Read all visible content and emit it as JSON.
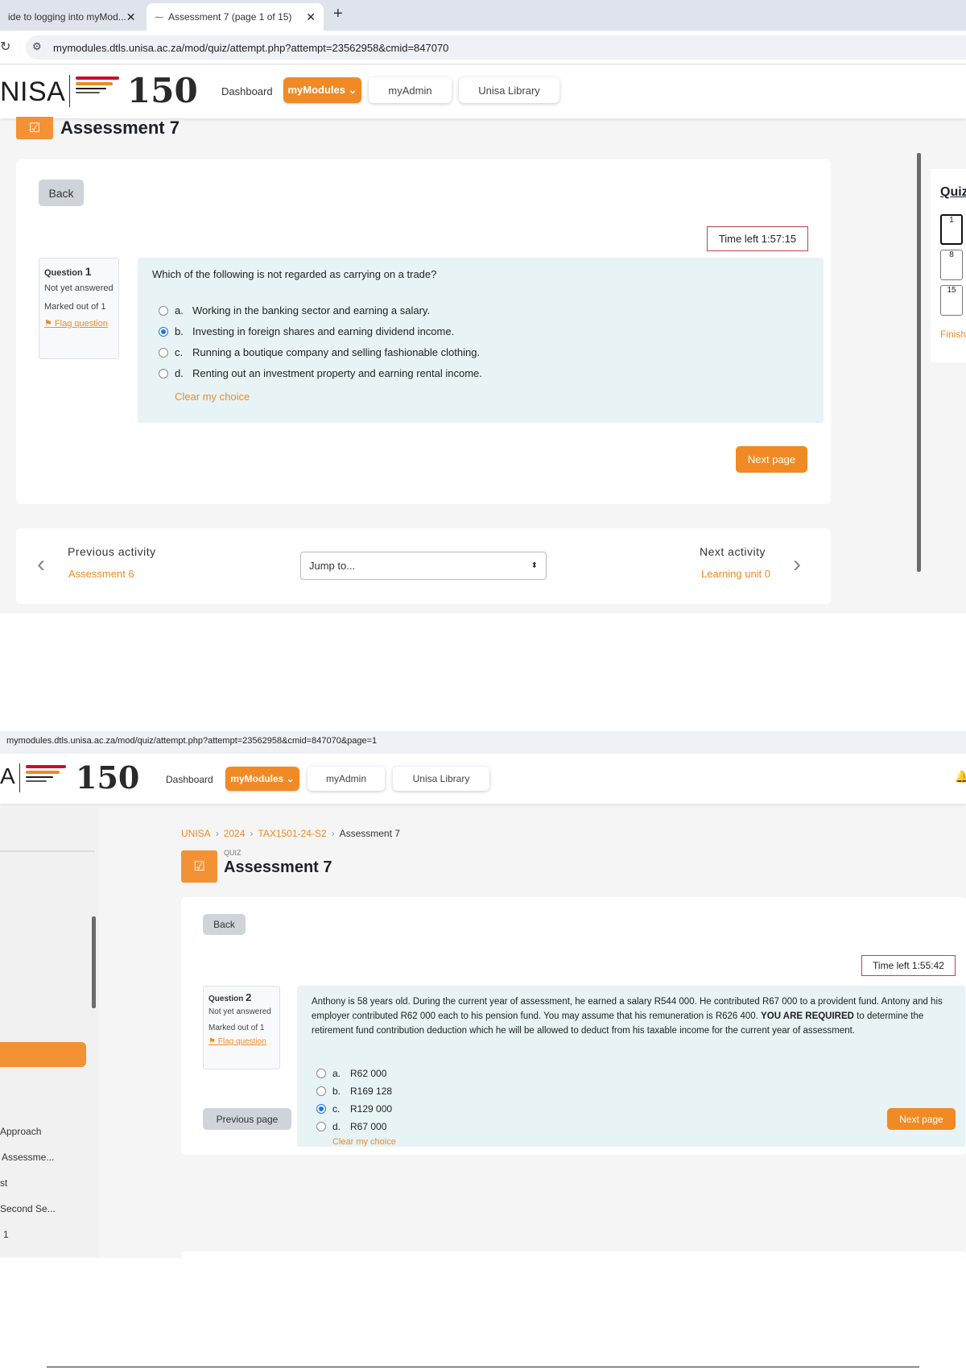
{
  "colors": {
    "accent": "#f08a24",
    "timer_border": "#c8404b",
    "question_bg": "#e7f3f5",
    "selected_radio": "#1a73e8"
  },
  "shot1": {
    "browser": {
      "tab_inactive": "ide to logging into myMod...",
      "tab_active": "Assessment 7 (page 1 of 15)",
      "tab_close": "✕",
      "new_tab": "+",
      "url": "mymodules.dtls.unisa.ac.za/mod/quiz/attempt.php?attempt=23562958&cmid=847070"
    },
    "nav": {
      "logo_text": "NISA",
      "logo_150": "150",
      "dashboard": "Dashboard",
      "mymodules": "myModules ⌄",
      "myadmin": "myAdmin",
      "library": "Unisa Library"
    },
    "page_title": "Assessment 7",
    "back": "Back",
    "timer": "Time left 1:57:15",
    "question": {
      "label": "Question",
      "number": "1",
      "state": "Not yet answered",
      "marked": "Marked out of 1",
      "flag": "Flag question",
      "text": "Which of the following is not regarded as carrying on a trade?",
      "options": [
        {
          "letter": "a.",
          "text": "Working in the banking sector and earning a salary.",
          "selected": false
        },
        {
          "letter": "b.",
          "text": "Investing in foreign shares and earning dividend income.",
          "selected": true
        },
        {
          "letter": "c.",
          "text": "Running a boutique company and selling fashionable clothing.",
          "selected": false
        },
        {
          "letter": "d.",
          "text": "Renting out an investment property and earning rental income.",
          "selected": false
        }
      ],
      "clear": "Clear my choice"
    },
    "next_page": "Next page",
    "activity": {
      "prev_heading": "Previous activity",
      "prev_link": "Assessment 6",
      "jump": "Jump to...",
      "next_heading": "Next activity",
      "next_link": "Learning unit 0"
    },
    "quiz_nav": {
      "title": "Quiz",
      "cells": [
        "1",
        "8",
        "15"
      ],
      "finish": "Finish"
    }
  },
  "shot2": {
    "url": "mymodules.dtls.unisa.ac.za/mod/quiz/attempt.php?attempt=23562958&cmid=847070&page=1",
    "nav": {
      "logo_text": "A",
      "logo_150": "150",
      "dashboard": "Dashboard",
      "mymodules": "myModules ⌄",
      "myadmin": "myAdmin",
      "library": "Unisa Library"
    },
    "sidebar_items": [
      "Approach",
      "Assessme...",
      "st",
      "Second Se...",
      "1"
    ],
    "breadcrumb": [
      "UNISA",
      "2024",
      "TAX1501-24-S2",
      "Assessment 7"
    ],
    "quiz_label": "QUIZ",
    "page_title": "Assessment 7",
    "back": "Back",
    "timer": "Time left 1:55:42",
    "question": {
      "label": "Question",
      "number": "2",
      "state": "Not yet answered",
      "marked": "Marked out of 1",
      "flag": "Flag question",
      "text_start": "Anthony is 58 years old. During the current year of assessment, he earned a salary R544 000. He contributed R67 000 to a provident fund. Antony and his employer contributed R62 000 each to his pension fund. You may assume that his remuneration is R626 400. ",
      "text_bold": "YOU ARE REQUIRED",
      "text_end": " to determine the retirement fund contribution deduction which he will be allowed to deduct from his taxable income for the current year of assessment.",
      "options": [
        {
          "letter": "a.",
          "text": "R62 000",
          "selected": false
        },
        {
          "letter": "b.",
          "text": "R169 128",
          "selected": false
        },
        {
          "letter": "c.",
          "text": "R129 000",
          "selected": true
        },
        {
          "letter": "d.",
          "text": "R67 000",
          "selected": false
        }
      ],
      "clear": "Clear my choice"
    },
    "previous_page": "Previous page",
    "next_page": "Next page"
  }
}
